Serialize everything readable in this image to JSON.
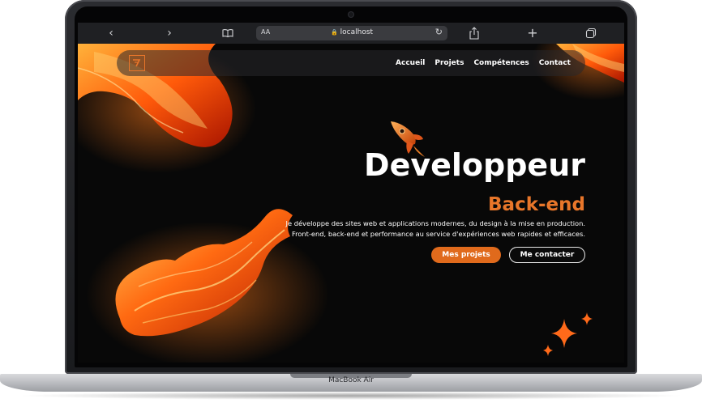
{
  "device": {
    "label": "MacBook Air"
  },
  "browser": {
    "text_size_label": "AA",
    "url": "localhost",
    "back_icon": "chevron-left-icon",
    "forward_icon": "chevron-right-icon",
    "bookmarks_icon": "book-icon",
    "reload_icon": "reload-icon",
    "share_icon": "share-icon",
    "new_tab_icon": "plus-icon",
    "tabs_icon": "tabs-icon"
  },
  "nav": {
    "links": [
      "Accueil",
      "Projets",
      "Compétences",
      "Contact"
    ]
  },
  "hero": {
    "title": "Developpeur",
    "subtitle": "Back-end",
    "description_line1": "Je développe des sites web et applications modernes, du design à la mise en production.",
    "description_line2": "Front-end, back-end et performance au service d'expériences web rapides et efficaces.",
    "primary_button": "Mes projets",
    "secondary_button": "Me contacter"
  },
  "colors": {
    "accent": "#e8762a",
    "page_background": "#080808",
    "text": "#ffffff"
  }
}
